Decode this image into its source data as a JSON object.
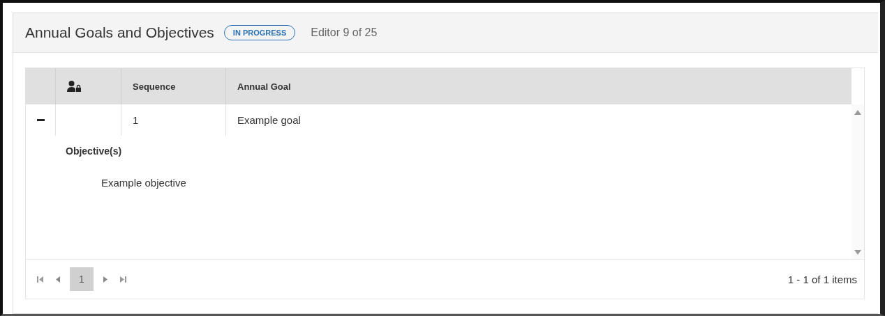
{
  "header": {
    "title": "Annual Goals and Objectives",
    "status": "IN PROGRESS",
    "editor": "Editor 9 of 25"
  },
  "table": {
    "columns": [
      {
        "kind": "expander"
      },
      {
        "kind": "icon"
      },
      {
        "kind": "text",
        "label": "Sequence"
      },
      {
        "kind": "text",
        "label": "Annual Goal"
      }
    ],
    "rows": [
      {
        "expanded": true,
        "cells": [
          "1",
          "Example goal"
        ],
        "detail": {
          "heading": "Objective(s)",
          "items": [
            "Example objective"
          ]
        }
      }
    ]
  },
  "pager": {
    "pages": [
      {
        "label": "1",
        "selected": true
      }
    ],
    "summary": "1 - 1 of 1 items"
  }
}
